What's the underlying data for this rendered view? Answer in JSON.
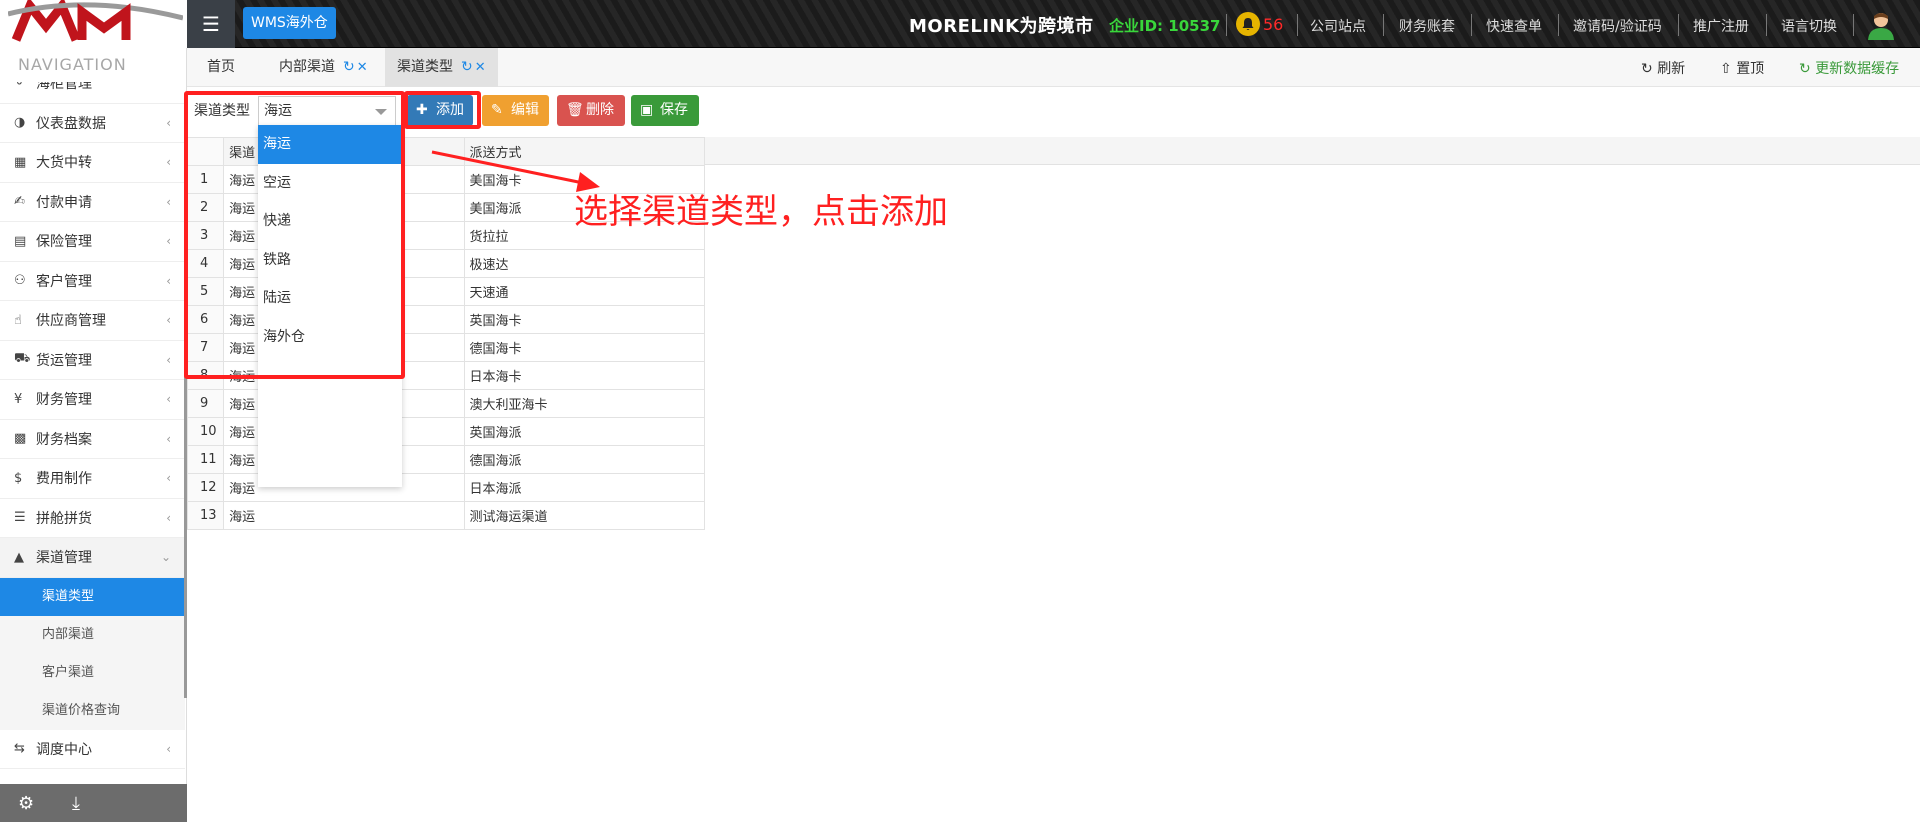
{
  "topbar": {
    "wms_button": "WMS海外仓",
    "brand": "MORELINK为跨境市",
    "enterprise_label": "企业ID:",
    "enterprise_id": "10537",
    "notification_count": "56",
    "links": [
      "公司站点",
      "财务账套",
      "快速查单",
      "邀请码/验证码",
      "推广注册",
      "语言切换"
    ]
  },
  "sidebar": {
    "title": "NAVIGATION",
    "items": [
      {
        "label": "海柜管理",
        "icon": "ship-icon"
      },
      {
        "label": "仪表盘数据",
        "icon": "pie-chart-icon"
      },
      {
        "label": "大货中转",
        "icon": "grid-icon"
      },
      {
        "label": "付款申请",
        "icon": "handshake-icon"
      },
      {
        "label": "保险管理",
        "icon": "document-icon"
      },
      {
        "label": "客户管理",
        "icon": "users-icon"
      },
      {
        "label": "供应商管理",
        "icon": "thumbs-up-icon"
      },
      {
        "label": "货运管理",
        "icon": "truck-icon"
      },
      {
        "label": "财务管理",
        "icon": "yen-icon"
      },
      {
        "label": "财务档案",
        "icon": "book-icon"
      },
      {
        "label": "费用制作",
        "icon": "dollar-icon"
      },
      {
        "label": "拼舱拼货",
        "icon": "list-icon"
      },
      {
        "label": "渠道管理",
        "icon": "road-icon"
      }
    ],
    "sub_items": [
      "渠道类型",
      "内部渠道",
      "客户渠道",
      "渠道价格查询"
    ],
    "after_item": {
      "label": "调度中心",
      "icon": "retweet-icon"
    }
  },
  "tabs": {
    "items": [
      "首页",
      "内部渠道",
      "渠道类型"
    ],
    "actions": [
      "刷新",
      "置顶",
      "更新数据缓存"
    ]
  },
  "toolbar": {
    "type_label": "渠道类型",
    "type_value": "海运",
    "add": "添加",
    "edit": "编辑",
    "delete": "删除",
    "save": "保存"
  },
  "grid": {
    "headers": [
      "渠道",
      "派送方式"
    ],
    "rows": [
      [
        "1",
        "海运",
        "美国海卡"
      ],
      [
        "2",
        "海运",
        "美国海派"
      ],
      [
        "3",
        "海运",
        "货拉拉"
      ],
      [
        "4",
        "海运",
        "极速达"
      ],
      [
        "5",
        "海运",
        "天速通"
      ],
      [
        "6",
        "海运",
        "英国海卡"
      ],
      [
        "7",
        "海运",
        "德国海卡"
      ],
      [
        "8",
        "海运",
        "日本海卡"
      ],
      [
        "9",
        "海运",
        "澳大利亚海卡"
      ],
      [
        "10",
        "海运",
        "英国海派"
      ],
      [
        "11",
        "海运",
        "德国海派"
      ],
      [
        "12",
        "海运",
        "日本海派"
      ],
      [
        "13",
        "海运",
        "测试海运渠道"
      ]
    ]
  },
  "dropdown": {
    "options": [
      "海运",
      "空运",
      "快递",
      "铁路",
      "陆运",
      "海外仓"
    ],
    "selected": "海运"
  },
  "annotation": {
    "text": "选择渠道类型，点击添加",
    "color": "#ff2020"
  }
}
